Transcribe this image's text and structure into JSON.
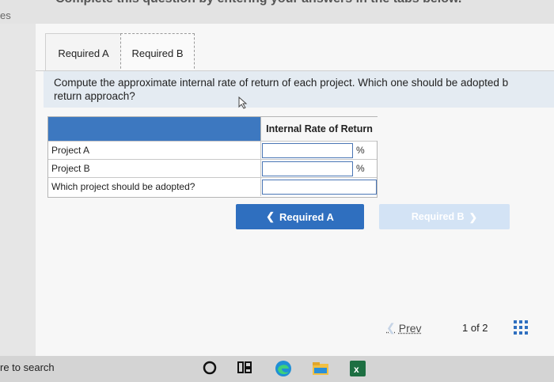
{
  "header": {
    "title_fragment": "Complete this question by entering your answers in the tabs below.",
    "left_fragment": "es"
  },
  "tabs": [
    {
      "label": "Required A"
    },
    {
      "label": "Required B"
    }
  ],
  "question": {
    "text": "Compute the approximate internal rate of return of each project. Which one should be adopted b\nreturn approach?"
  },
  "table": {
    "column_header": "Internal Rate of Return",
    "rows": [
      {
        "label": "Project A",
        "value": "",
        "unit": "%"
      },
      {
        "label": "Project B",
        "value": "",
        "unit": "%"
      },
      {
        "label": "Which project should be adopted?",
        "value": "",
        "unit": ""
      }
    ]
  },
  "buttons": {
    "prev_required": "Required A",
    "next_required": "Required B"
  },
  "pagination": {
    "prev_label": "Prev",
    "current": "1",
    "of_label": "of",
    "total": "2",
    "display": "1 of 2"
  },
  "taskbar": {
    "search_fragment": "re to search"
  },
  "colors": {
    "accent": "#2f6fbf",
    "table_header": "#3d78c0",
    "disabled_button": "#d3e3f5"
  }
}
